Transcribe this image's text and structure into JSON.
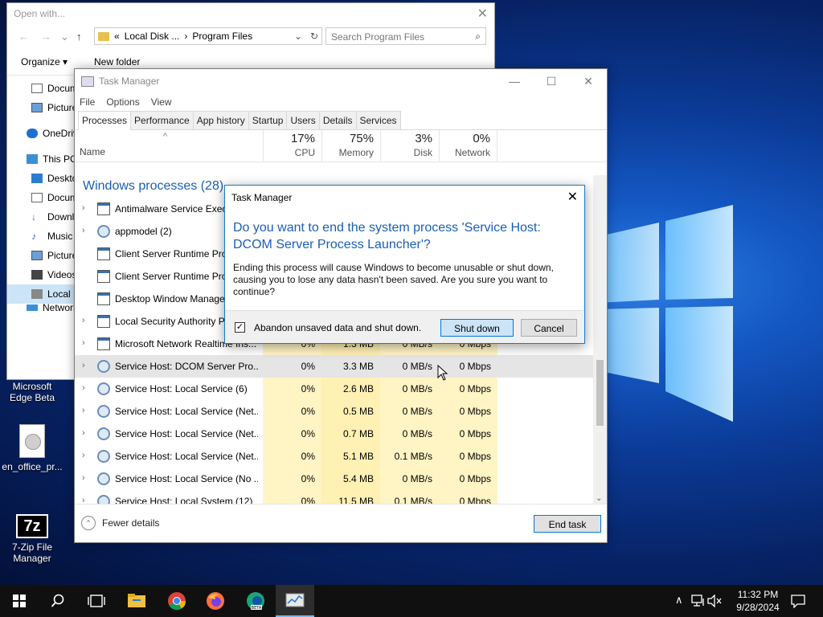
{
  "desktop": {
    "icons": [
      {
        "label": "Microsoft Edge Beta"
      },
      {
        "label": "en_office_pr..."
      },
      {
        "label": "7-Zip File Manager"
      }
    ]
  },
  "explorer": {
    "title": "Open with...",
    "address": {
      "prefix": "«",
      "part1": "Local Disk ...",
      "sep": "›",
      "part2": "Program Files"
    },
    "search_placeholder": "Search Program Files",
    "toolbar": {
      "organize": "Organize ▾",
      "new_folder": "New folder"
    },
    "nav_items": [
      {
        "label": "Documents"
      },
      {
        "label": "Pictures"
      },
      {
        "label": "OneDrive"
      },
      {
        "label": "This PC"
      },
      {
        "label": "Desktop"
      },
      {
        "label": "Documents"
      },
      {
        "label": "Downloads"
      },
      {
        "label": "Music"
      },
      {
        "label": "Pictures"
      },
      {
        "label": "Videos"
      },
      {
        "label": "Local Disk"
      },
      {
        "label": "Network"
      }
    ]
  },
  "taskmgr": {
    "title": "Task Manager",
    "menu": {
      "file": "File",
      "options": "Options",
      "view": "View"
    },
    "tabs": [
      {
        "label": "Processes"
      },
      {
        "label": "Performance"
      },
      {
        "label": "App history"
      },
      {
        "label": "Startup"
      },
      {
        "label": "Users"
      },
      {
        "label": "Details"
      },
      {
        "label": "Services"
      }
    ],
    "columns": {
      "name": "Name",
      "cpu": {
        "pct": "17%",
        "label": "CPU"
      },
      "memory": {
        "pct": "75%",
        "label": "Memory"
      },
      "disk": {
        "pct": "3%",
        "label": "Disk"
      },
      "network": {
        "pct": "0%",
        "label": "Network"
      }
    },
    "group_label": "Windows processes (28)",
    "rows": [
      {
        "name": "Antimalware Service Executable",
        "expand": "›",
        "cpu": "",
        "mem": "",
        "disk": "",
        "net": ""
      },
      {
        "name": "appmodel (2)",
        "expand": "›",
        "cpu": "",
        "mem": "",
        "disk": "",
        "net": ""
      },
      {
        "name": "Client Server Runtime Process",
        "expand": "",
        "cpu": "",
        "mem": "",
        "disk": "",
        "net": ""
      },
      {
        "name": "Client Server Runtime Process",
        "expand": "",
        "cpu": "",
        "mem": "",
        "disk": "",
        "net": ""
      },
      {
        "name": "Desktop Window Manager",
        "expand": "",
        "cpu": "",
        "mem": "",
        "disk": "",
        "net": ""
      },
      {
        "name": "Local Security Authority Process",
        "expand": "›",
        "cpu": "",
        "mem": "",
        "disk": "",
        "net": ""
      },
      {
        "name": "Microsoft Network Realtime Ins...",
        "expand": "›",
        "cpu": "0%",
        "mem": "1.3 MB",
        "disk": "0 MB/s",
        "net": "0 Mbps"
      },
      {
        "name": "Service Host: DCOM Server Pro...",
        "expand": "›",
        "cpu": "0%",
        "mem": "3.3 MB",
        "disk": "0 MB/s",
        "net": "0 Mbps"
      },
      {
        "name": "Service Host: Local Service (6)",
        "expand": "›",
        "cpu": "0%",
        "mem": "2.6 MB",
        "disk": "0 MB/s",
        "net": "0 Mbps"
      },
      {
        "name": "Service Host: Local Service (Net...",
        "expand": "›",
        "cpu": "0%",
        "mem": "0.5 MB",
        "disk": "0 MB/s",
        "net": "0 Mbps"
      },
      {
        "name": "Service Host: Local Service (Net...",
        "expand": "›",
        "cpu": "0%",
        "mem": "0.7 MB",
        "disk": "0 MB/s",
        "net": "0 Mbps"
      },
      {
        "name": "Service Host: Local Service (Net...",
        "expand": "›",
        "cpu": "0%",
        "mem": "5.1 MB",
        "disk": "0.1 MB/s",
        "net": "0 Mbps"
      },
      {
        "name": "Service Host: Local Service (No ...",
        "expand": "›",
        "cpu": "0%",
        "mem": "5.4 MB",
        "disk": "0 MB/s",
        "net": "0 Mbps"
      },
      {
        "name": "Service Host: Local System (12)",
        "expand": "›",
        "cpu": "0%",
        "mem": "11.5 MB",
        "disk": "0.1 MB/s",
        "net": "0 Mbps"
      }
    ],
    "fewer_details": "Fewer details",
    "end_task": "End task"
  },
  "dialog": {
    "title": "Task Manager",
    "heading": "Do you want to end the system process 'Service Host: DCOM Server Process Launcher'?",
    "body": "Ending this process will cause Windows to become unusable or shut down, causing you to lose any data hasn't been saved. Are you sure you want to continue?",
    "checkbox_label": "Abandon unsaved data and shut down.",
    "checkbox_mark": "✓",
    "shutdown": "Shut down",
    "cancel": "Cancel"
  },
  "taskbar": {
    "time": "11:32 PM",
    "date": "9/28/2024"
  },
  "colors": {
    "accent": "#0078d7",
    "heading_blue": "#1a5fb4",
    "cpu_heat": "#fff4c4"
  }
}
